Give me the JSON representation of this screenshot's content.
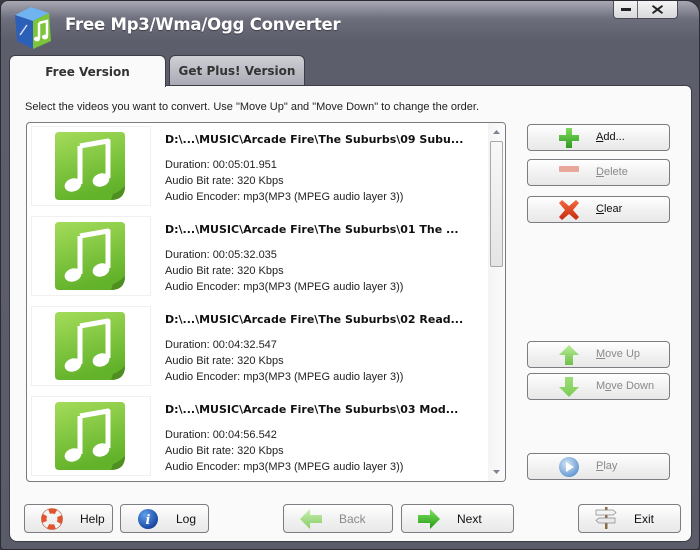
{
  "window": {
    "title": "Free Mp3/Wma/Ogg Converter",
    "minimize_icon": "minimize-icon",
    "close_icon": "close-icon"
  },
  "tabs": [
    {
      "label": "Free Version",
      "active": true
    },
    {
      "label": "Get Plus! Version",
      "active": false
    }
  ],
  "instructions": "Select the videos you want to convert. Use \"Move Up\" and \"Move Down\" to change the order.",
  "files": [
    {
      "path": "D:\\...\\MUSIC\\Arcade Fire\\The Suburbs\\09 Subu...",
      "duration": "Duration: 00:05:01.951",
      "bitrate": "Audio Bit rate: 320 Kbps",
      "encoder": "Audio Encoder: mp3(MP3 (MPEG audio layer 3))"
    },
    {
      "path": "D:\\...\\MUSIC\\Arcade Fire\\The Suburbs\\01 The ...",
      "duration": "Duration: 00:05:32.035",
      "bitrate": "Audio Bit rate: 320 Kbps",
      "encoder": "Audio Encoder: mp3(MP3 (MPEG audio layer 3))"
    },
    {
      "path": "D:\\...\\MUSIC\\Arcade Fire\\The Suburbs\\02 Read...",
      "duration": "Duration: 00:04:32.547",
      "bitrate": "Audio Bit rate: 320 Kbps",
      "encoder": "Audio Encoder: mp3(MP3 (MPEG audio layer 3))"
    },
    {
      "path": "D:\\...\\MUSIC\\Arcade Fire\\The Suburbs\\03 Mod...",
      "duration": "Duration: 00:04:56.542",
      "bitrate": "Audio Bit rate: 320 Kbps",
      "encoder": "Audio Encoder: mp3(MP3 (MPEG audio layer 3))"
    }
  ],
  "side_buttons": {
    "add": {
      "mnemonic": "A",
      "rest": "dd...",
      "enabled": true,
      "icon": "plus-icon"
    },
    "delete": {
      "mnemonic": "D",
      "rest": "elete",
      "enabled": false,
      "icon": "minus-icon"
    },
    "clear": {
      "mnemonic": "C",
      "rest": "lear",
      "enabled": true,
      "icon": "x-icon"
    },
    "move_up": {
      "pre": "",
      "mnemonic": "M",
      "rest": "ove Up",
      "enabled": false,
      "icon": "arrow-up-icon"
    },
    "move_down": {
      "pre": "M",
      "mnemonic": "o",
      "rest": "ve Down",
      "enabled": false,
      "icon": "arrow-down-icon"
    },
    "play": {
      "mnemonic": "P",
      "rest": "lay",
      "enabled": false,
      "icon": "play-icon"
    }
  },
  "bottom_buttons": {
    "help": {
      "label": "Help",
      "icon": "lifebuoy-icon"
    },
    "log": {
      "label": "Log",
      "icon": "info-icon"
    },
    "back": {
      "label": "Back",
      "icon": "arrow-left-icon",
      "enabled": false
    },
    "next": {
      "label": "Next",
      "icon": "arrow-right-icon",
      "enabled": true
    },
    "exit": {
      "label": "Exit",
      "icon": "signpost-icon"
    }
  },
  "colors": {
    "chrome": "#5d5e6c",
    "panel": "#fafafa",
    "music_green": "#7cc43a",
    "add_green": "#3aa52a",
    "clear_red": "#e0401c"
  }
}
